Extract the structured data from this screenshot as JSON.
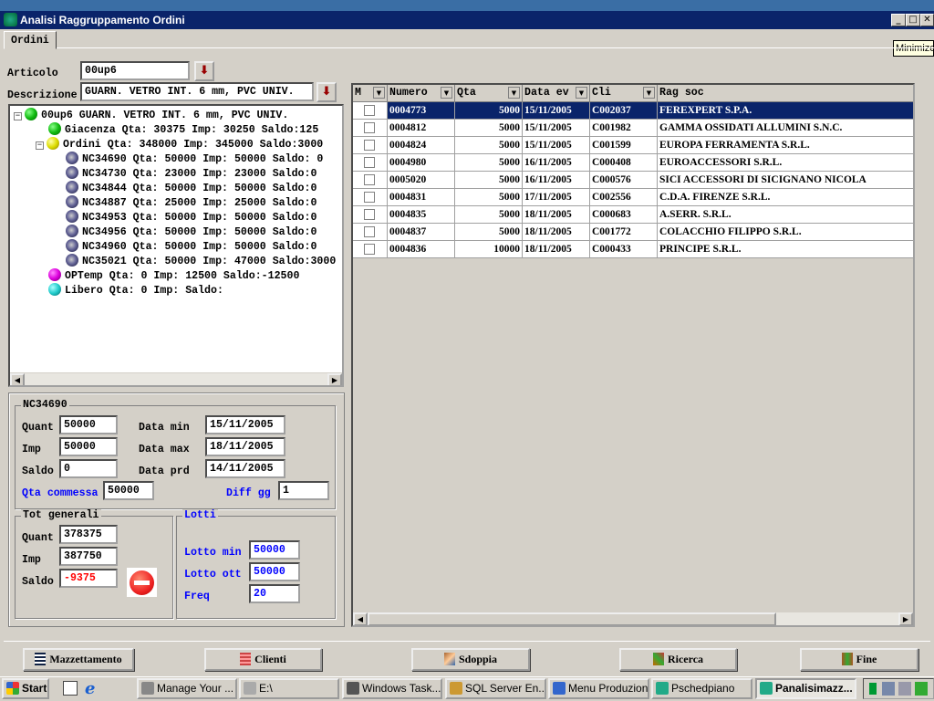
{
  "window": {
    "title": "Analisi Raggruppamento Ordini",
    "tooltip": "Minimize",
    "min": "_",
    "max": "□",
    "close": "✕"
  },
  "tabs": [
    {
      "label": "Ordini"
    }
  ],
  "articolo": {
    "label": "Articolo",
    "value": "00up6"
  },
  "descrizione": {
    "label": "Descrizione",
    "value": "GUARN. VETRO INT. 6 mm, PVC UNIV."
  },
  "tree": [
    {
      "text": "00up6 GUARN. VETRO INT. 6 mm, PVC UNIV.",
      "level": 0,
      "icon": "green-ball",
      "expander": "−"
    },
    {
      "text": "Giacenza Qta: 30375 Imp: 30250 Saldo:125",
      "level": 1,
      "icon": "green-ball"
    },
    {
      "text": "Ordini Qta: 348000 Imp: 345000 Saldo:3000",
      "level": 1,
      "icon": "yellow-ball",
      "expander": "−"
    },
    {
      "text": "NC34690  Qta: 50000  Imp: 50000  Saldo: 0",
      "level": 2,
      "icon": "order-ball"
    },
    {
      "text": "NC34730 Qta: 23000 Imp: 23000 Saldo:0",
      "level": 2,
      "icon": "order-ball"
    },
    {
      "text": "NC34844 Qta: 50000 Imp: 50000 Saldo:0",
      "level": 2,
      "icon": "order-ball"
    },
    {
      "text": "NC34887 Qta: 25000 Imp: 25000 Saldo:0",
      "level": 2,
      "icon": "order-ball"
    },
    {
      "text": "NC34953 Qta: 50000 Imp: 50000 Saldo:0",
      "level": 2,
      "icon": "order-ball"
    },
    {
      "text": "NC34956 Qta: 50000 Imp: 50000 Saldo:0",
      "level": 2,
      "icon": "order-ball"
    },
    {
      "text": "NC34960 Qta: 50000 Imp: 50000 Saldo:0",
      "level": 2,
      "icon": "order-ball"
    },
    {
      "text": "NC35021 Qta: 50000 Imp: 47000 Saldo:3000",
      "level": 2,
      "icon": "order-ball"
    },
    {
      "text": "OPTemp Qta: 0 Imp: 12500 Saldo:-12500",
      "level": 1,
      "icon": "magenta-ball"
    },
    {
      "text": "Libero Qta: 0 Imp:  Saldo:",
      "level": 1,
      "icon": "cyan-ball"
    }
  ],
  "detail": {
    "title": "NC34690",
    "quant_label": "Quant",
    "quant": "50000",
    "imp_label": "Imp",
    "imp": "50000",
    "saldo_label": "Saldo",
    "saldo": "0",
    "data_min_label": "Data min",
    "data_min": "15/11/2005",
    "data_max_label": "Data max",
    "data_max": "18/11/2005",
    "data_prd_label": "Data prd",
    "data_prd": "14/11/2005",
    "qta_commessa_label": "Qta commessa",
    "qta_commessa": "50000",
    "diff_gg_label": "Diff gg",
    "diff_gg": "1"
  },
  "totali": {
    "title": "Tot generali",
    "quant_label": "Quant",
    "quant": "378375",
    "imp_label": "Imp",
    "imp": "387750",
    "saldo_label": "Saldo",
    "saldo": "-9375",
    "saldo_color": "#ff0000",
    "status_icon": "no-entry-icon"
  },
  "lotti": {
    "title": "Lotti",
    "lotto_min_label": "Lotto min",
    "lotto_min": "50000",
    "lotto_ott_label": "Lotto ott",
    "lotto_ott": "50000",
    "freq_label": "Freq",
    "freq": "20"
  },
  "grid": {
    "columns": [
      "M",
      "Numero",
      "Qta",
      "Data ev",
      "Cli",
      "Rag soc"
    ],
    "selected_index": 0,
    "rows": [
      [
        "0004773",
        "5000",
        "15/11/2005",
        "C002037",
        "FEREXPERT S.P.A."
      ],
      [
        "0004812",
        "5000",
        "15/11/2005",
        "C001982",
        "GAMMA OSSIDATI ALLUMINI S.N.C."
      ],
      [
        "0004824",
        "5000",
        "15/11/2005",
        "C001599",
        "EUROPA FERRAMENTA S.R.L."
      ],
      [
        "0004980",
        "5000",
        "16/11/2005",
        "C000408",
        "EUROACCESSORI S.R.L."
      ],
      [
        "0005020",
        "5000",
        "16/11/2005",
        "C000576",
        "SICI ACCESSORI DI SICIGNANO NICOLA"
      ],
      [
        "0004831",
        "5000",
        "17/11/2005",
        "C002556",
        "C.D.A. FIRENZE S.R.L."
      ],
      [
        "0004835",
        "5000",
        "18/11/2005",
        "C000683",
        "A.SERR. S.R.L."
      ],
      [
        "0004837",
        "5000",
        "18/11/2005",
        "C001772",
        "COLACCHIO FILIPPO S.R.L."
      ],
      [
        "0004836",
        "10000",
        "18/11/2005",
        "C000433",
        "PRINCIPE S.R.L."
      ]
    ]
  },
  "buttons": {
    "mazzettamento": "Mazzettamento",
    "clienti": "Clienti",
    "sdoppia": "Sdoppia",
    "ricerca": "Ricerca",
    "fine": "Fine"
  },
  "taskbar": {
    "start": "Start",
    "items": [
      "Manage Your ...",
      "E:\\",
      "Windows Task...",
      "SQL Server En...",
      "Menu Produzione",
      "Pschedpiano",
      "Panalisimazz..."
    ],
    "active_index": 6
  },
  "colors": {
    "title_bar": "#0a246a",
    "selection": "#0a246a",
    "accent_blue": "#0000ff",
    "error_red": "#ff0000"
  }
}
